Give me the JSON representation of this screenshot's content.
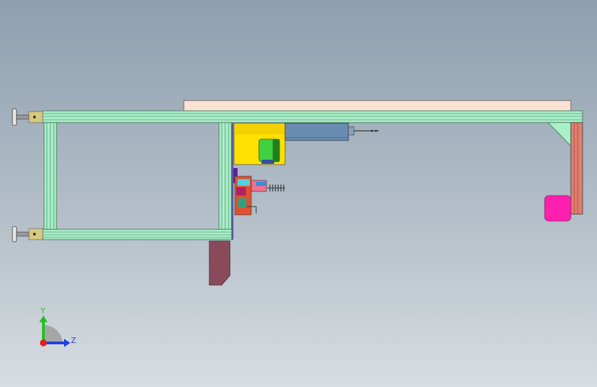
{
  "triad": {
    "y_label": "Y",
    "z_label": "Z"
  },
  "colors": {
    "frame": "#a8f0c8",
    "top_plate": "#fbe3d3",
    "leg": "#8a4a5a",
    "motor_yellow": "#ffe000",
    "motor_green": "#40d040",
    "cylinder_blue": "#6a8cb0",
    "foot_magenta": "#ff20b0",
    "post_salmon": "#e08070",
    "y_axis": "#20c020",
    "z_axis": "#2040e0"
  }
}
